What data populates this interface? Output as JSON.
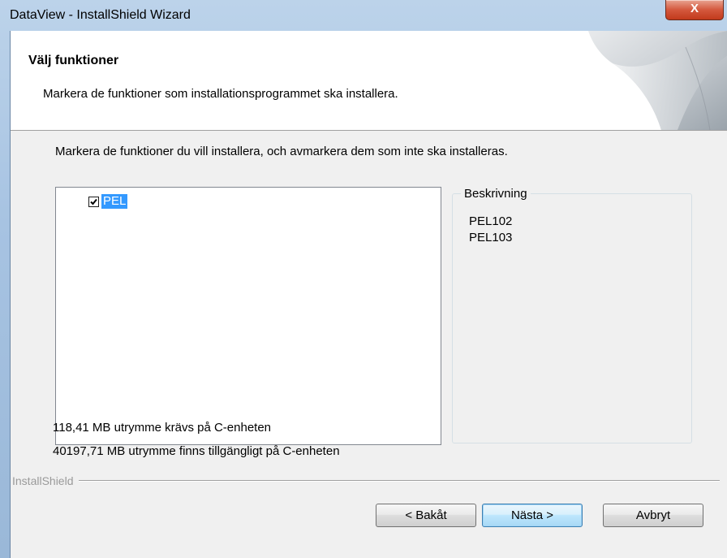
{
  "window": {
    "title": "DataView - InstallShield Wizard",
    "close_glyph": "X"
  },
  "header": {
    "title": "Välj funktioner",
    "subtitle": "Markera de funktioner som installationsprogrammet ska installera."
  },
  "instruction": "Markera de funktioner du vill installera,  och avmarkera dem som inte ska installeras.",
  "feature_tree": {
    "items": [
      {
        "label": "PEL",
        "checked": true,
        "selected": true
      }
    ]
  },
  "description": {
    "legend": "Beskrivning",
    "text": "PEL102\nPEL103"
  },
  "space": {
    "required": "118,41 MB utrymme krävs på C-enheten",
    "available": "40197,71 MB utrymme finns tillgängligt på C-enheten"
  },
  "brand": "InstallShield",
  "buttons": {
    "back": "< Bakåt",
    "next": "Nästa >",
    "cancel": "Avbryt"
  },
  "colors": {
    "selection": "#3399ff",
    "close_button": "#c23a1c",
    "dialog_bg": "#f0f0f0"
  }
}
